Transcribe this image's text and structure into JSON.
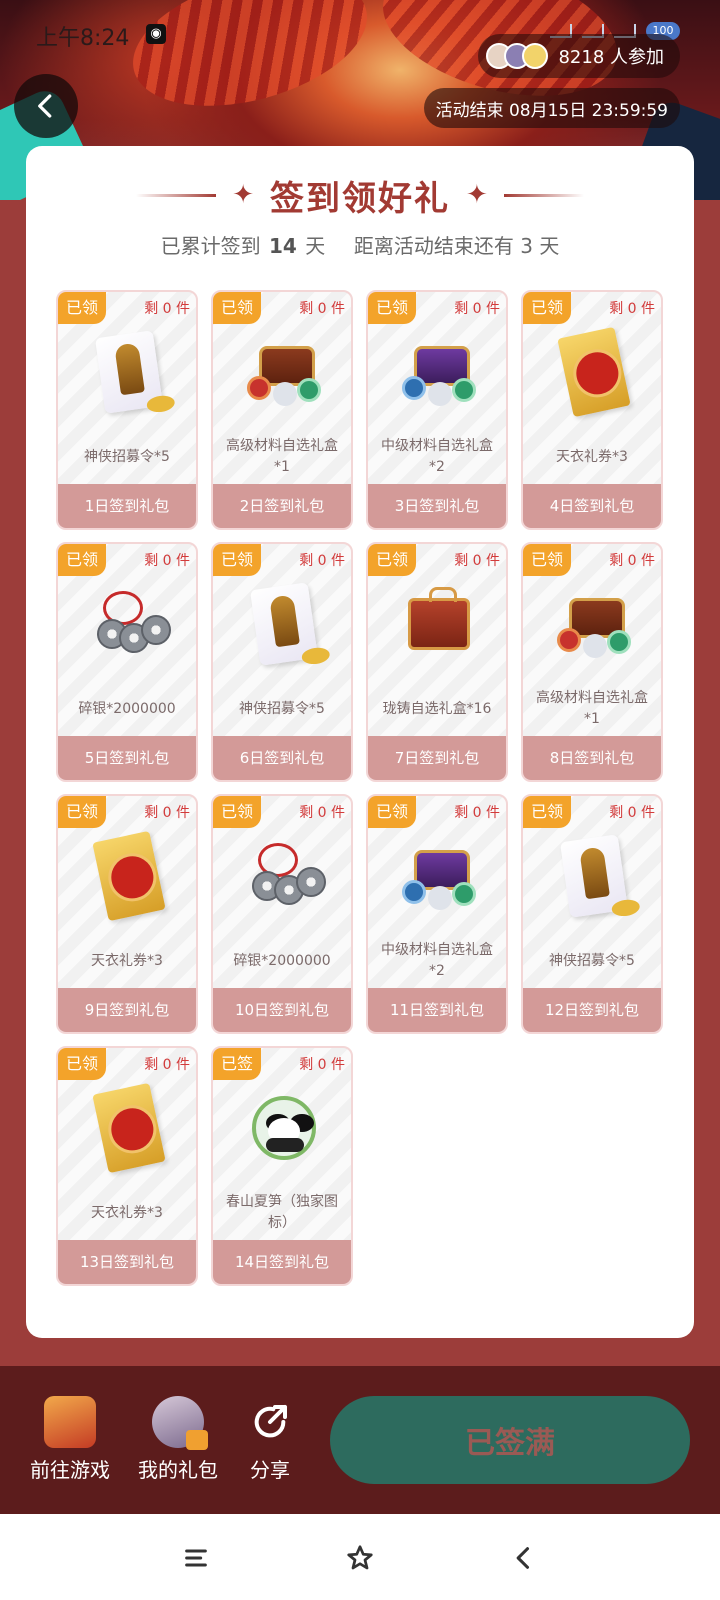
{
  "status_bar": {
    "time": "上午8:24",
    "battery": "100"
  },
  "header": {
    "participants": "8218 人参加",
    "end_time": "活动结束 08月15日 23:59:59"
  },
  "title": "签到领好礼",
  "subtitle": {
    "prefix": "已累计签到",
    "days": "14",
    "days_unit": "天",
    "remaining_text": "距离活动结束还有 3 天"
  },
  "rewards": [
    {
      "badge": "已领",
      "remain": "剩 0 件",
      "icon": "scroll-icon",
      "name": "神侠招募令*5",
      "footer": "1日签到礼包"
    },
    {
      "badge": "已领",
      "remain": "剩 0 件",
      "icon": "chest-icon",
      "name": "高级材料自选礼盒*1",
      "footer": "2日签到礼包"
    },
    {
      "badge": "已领",
      "remain": "剩 0 件",
      "icon": "purple-chest-icon",
      "name": "中级材料自选礼盒*2",
      "footer": "3日签到礼包"
    },
    {
      "badge": "已领",
      "remain": "剩 0 件",
      "icon": "ticket-icon",
      "name": "天衣礼券*3",
      "footer": "4日签到礼包"
    },
    {
      "badge": "已领",
      "remain": "剩 0 件",
      "icon": "coins-icon",
      "name": "碎银*2000000",
      "footer": "5日签到礼包"
    },
    {
      "badge": "已领",
      "remain": "剩 0 件",
      "icon": "scroll-icon",
      "name": "神侠招募令*5",
      "footer": "6日签到礼包"
    },
    {
      "badge": "已领",
      "remain": "剩 0 件",
      "icon": "crate-icon",
      "name": "珑铸自选礼盒*16",
      "footer": "7日签到礼包"
    },
    {
      "badge": "已领",
      "remain": "剩 0 件",
      "icon": "chest-icon",
      "name": "高级材料自选礼盒*1",
      "footer": "8日签到礼包"
    },
    {
      "badge": "已领",
      "remain": "剩 0 件",
      "icon": "ticket-icon",
      "name": "天衣礼券*3",
      "footer": "9日签到礼包"
    },
    {
      "badge": "已领",
      "remain": "剩 0 件",
      "icon": "coins-icon",
      "name": "碎银*2000000",
      "footer": "10日签到礼包"
    },
    {
      "badge": "已领",
      "remain": "剩 0 件",
      "icon": "purple-chest-icon",
      "name": "中级材料自选礼盒*2",
      "footer": "11日签到礼包"
    },
    {
      "badge": "已领",
      "remain": "剩 0 件",
      "icon": "scroll-icon",
      "name": "神侠招募令*5",
      "footer": "12日签到礼包"
    },
    {
      "badge": "已领",
      "remain": "剩 0 件",
      "icon": "ticket-icon",
      "name": "天衣礼券*3",
      "footer": "13日签到礼包"
    },
    {
      "badge": "已签",
      "remain": "剩 0 件",
      "icon": "panda-icon",
      "name": "春山夏笋（独家图标）",
      "footer": "14日签到礼包"
    }
  ],
  "bottom_bar": {
    "go_game": "前往游戏",
    "my_gifts": "我的礼包",
    "share": "分享",
    "signed_button": "已签满"
  },
  "colors": {
    "accent": "#a23a33",
    "badge": "#f3a32a",
    "tile_footer": "#d39a98",
    "bottom_bar": "#5c1c1c",
    "signed_button": "#2d6b5e"
  }
}
